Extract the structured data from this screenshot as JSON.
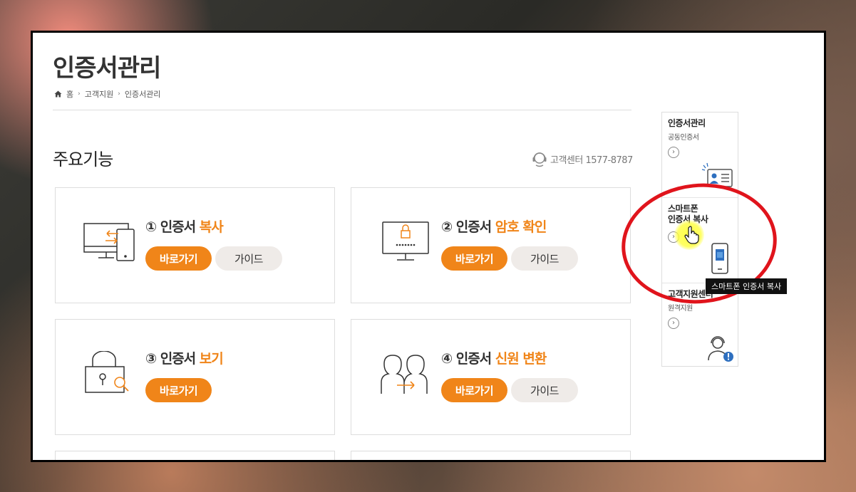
{
  "page": {
    "title": "인증서관리",
    "breadcrumb": [
      "홈",
      "고객지원",
      "인증서관리"
    ],
    "section_title": "주요기능",
    "customer_center": "고객센터 1577-8787"
  },
  "cards": [
    {
      "num": "①",
      "title": "인증서",
      "highlight": "복사",
      "go_label": "바로가기",
      "guide_label": "가이드",
      "icon": "monitor-transfer-icon"
    },
    {
      "num": "②",
      "title": "인증서",
      "highlight": "암호 확인",
      "go_label": "바로가기",
      "guide_label": "가이드",
      "icon": "monitor-lock-icon"
    },
    {
      "num": "③",
      "title": "인증서",
      "highlight": "보기",
      "go_label": "바로가기",
      "guide_label": "",
      "icon": "lock-search-icon"
    },
    {
      "num": "④",
      "title": "인증서",
      "highlight": "신원 변환",
      "go_label": "바로가기",
      "guide_label": "가이드",
      "icon": "people-arrow-icon"
    }
  ],
  "sidebar": {
    "items": [
      {
        "title": "인증서관리",
        "subtitle": "공동인증서",
        "icon": "id-card-icon"
      },
      {
        "title": "스마트폰\n인증서 복사",
        "subtitle": "",
        "icon": "smartphone-icon"
      },
      {
        "title": "고객지원센터",
        "subtitle": "원격지원",
        "icon": "support-agent-icon"
      }
    ]
  },
  "tooltip": "스마트폰 인증서 복사",
  "colors": {
    "accent": "#f08519",
    "guide_bg": "#efebe8",
    "annotation": "#e0141c",
    "cursor_highlight": "#ffff3c"
  }
}
